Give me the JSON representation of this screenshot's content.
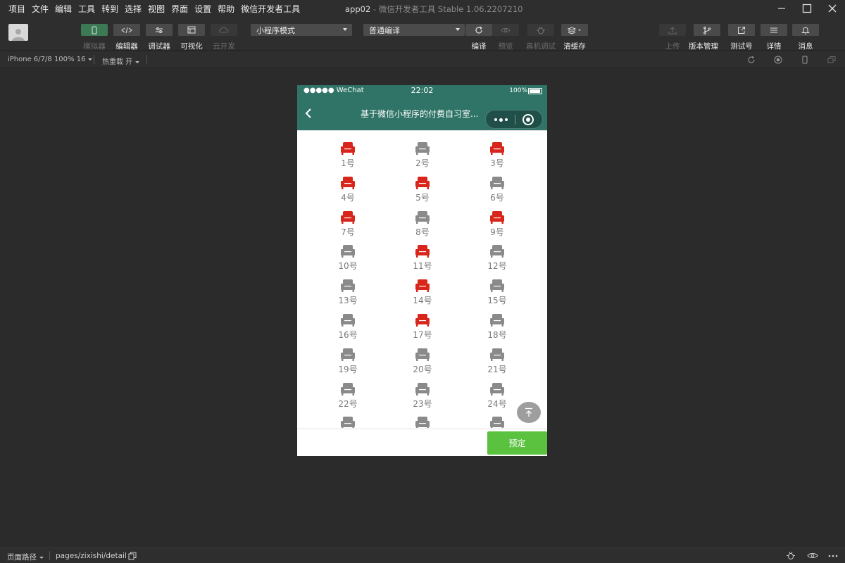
{
  "menu": [
    "项目",
    "文件",
    "编辑",
    "工具",
    "转到",
    "选择",
    "视图",
    "界面",
    "设置",
    "帮助",
    "微信开发者工具"
  ],
  "window": {
    "title": "app02",
    "subtitle": " - 微信开发者工具 Stable 1.06.2207210"
  },
  "toolbar": {
    "tools_left": [
      {
        "name": "simulator",
        "label": "模拟器",
        "icon": "phone-icon",
        "state": "active"
      },
      {
        "name": "editor",
        "label": "编辑器",
        "icon": "code-icon",
        "state": "normal"
      },
      {
        "name": "debugger",
        "label": "调试器",
        "icon": "sliders-icon",
        "state": "normal"
      },
      {
        "name": "visual",
        "label": "可视化",
        "icon": "layout-icon",
        "state": "normal"
      },
      {
        "name": "cloud",
        "label": "云开发",
        "icon": "cloud-icon",
        "state": "disabled"
      }
    ],
    "mode_select": "小程序模式",
    "compile_select": "普通编译",
    "actions": [
      {
        "name": "compile",
        "label": "编译",
        "icon": "refresh-icon",
        "state": "normal"
      },
      {
        "name": "preview",
        "label": "预览",
        "icon": "eye-icon",
        "state": "disabled"
      },
      {
        "name": "real-device",
        "label": "真机调试",
        "icon": "bug-icon",
        "state": "disabled"
      },
      {
        "name": "clear-cache",
        "label": "清缓存",
        "icon": "layers-icon",
        "state": "normal"
      }
    ],
    "right": [
      {
        "name": "upload",
        "label": "上传",
        "icon": "upload-icon",
        "state": "disabled"
      },
      {
        "name": "version",
        "label": "版本管理",
        "icon": "branch-icon",
        "state": "normal"
      },
      {
        "name": "test",
        "label": "测试号",
        "icon": "external-icon",
        "state": "normal"
      },
      {
        "name": "details",
        "label": "详情",
        "icon": "menu-icon",
        "state": "normal"
      },
      {
        "name": "messages",
        "label": "消息",
        "icon": "bell-icon",
        "state": "normal"
      }
    ]
  },
  "subbar": {
    "device": "iPhone 6/7/8 100% 16",
    "hot_reload": "热重载 开"
  },
  "phone": {
    "status": {
      "signal": "●●●●● WeChat",
      "time": "22:02",
      "battery": "100%"
    },
    "nav_title": "基于微信小程序的付费自习室...",
    "seats": [
      {
        "label": "1号",
        "status": "occupied"
      },
      {
        "label": "2号",
        "status": "free"
      },
      {
        "label": "3号",
        "status": "occupied"
      },
      {
        "label": "4号",
        "status": "occupied"
      },
      {
        "label": "5号",
        "status": "occupied"
      },
      {
        "label": "6号",
        "status": "free"
      },
      {
        "label": "7号",
        "status": "occupied"
      },
      {
        "label": "8号",
        "status": "free"
      },
      {
        "label": "9号",
        "status": "occupied"
      },
      {
        "label": "10号",
        "status": "free"
      },
      {
        "label": "11号",
        "status": "occupied"
      },
      {
        "label": "12号",
        "status": "free"
      },
      {
        "label": "13号",
        "status": "free"
      },
      {
        "label": "14号",
        "status": "occupied"
      },
      {
        "label": "15号",
        "status": "free"
      },
      {
        "label": "16号",
        "status": "free"
      },
      {
        "label": "17号",
        "status": "occupied"
      },
      {
        "label": "18号",
        "status": "free"
      },
      {
        "label": "19号",
        "status": "free"
      },
      {
        "label": "20号",
        "status": "free"
      },
      {
        "label": "21号",
        "status": "free"
      },
      {
        "label": "22号",
        "status": "free"
      },
      {
        "label": "23号",
        "status": "free"
      },
      {
        "label": "24号",
        "status": "free"
      },
      {
        "label": "",
        "status": "free"
      },
      {
        "label": "",
        "status": "free"
      },
      {
        "label": "",
        "status": "free"
      }
    ],
    "book_button": "预定",
    "colors": {
      "occupied": "#d8261c",
      "free": "#8a8a8a",
      "nav": "#2f7466",
      "book": "#5ac23f"
    }
  },
  "footer": {
    "path_label": "页面路径",
    "path": "pages/zixishi/detail"
  }
}
